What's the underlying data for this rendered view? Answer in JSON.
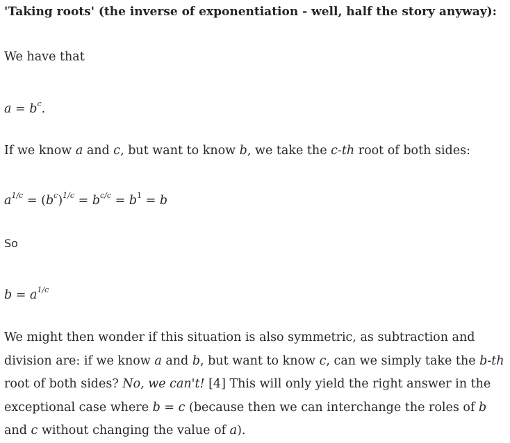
{
  "heading": "'Taking roots' (the inverse of exponentiation - well, half the story anyway):",
  "line_we_have_that": "We have that",
  "eq1": {
    "a": "a",
    "eq": " = ",
    "b": "b",
    "c": "c",
    "dot": "."
  },
  "line_if_we_know": {
    "t1": "If we know ",
    "a": "a",
    "t2": " and ",
    "c": "c",
    "t3": ", but want to know ",
    "b": "b",
    "t4": ", we take the ",
    "cth": "c-th",
    "t5": " root of both sides:"
  },
  "eq2": {
    "a": "a",
    "exp_1c": "1/c",
    "eq": " = ",
    "open": "(",
    "b": "b",
    "c": "c",
    "close": ")",
    "b2": "b",
    "exp_cc": "c/c",
    "b3": "b",
    "exp_1": "1",
    "b4": "b"
  },
  "line_so": "So",
  "eq3": {
    "b": "b",
    "eq": " = ",
    "a": "a",
    "exp_1c": "1/c"
  },
  "paragraph": {
    "p1": "We might then wonder if this situation is also symmetric, as subtraction and division are: if we know ",
    "a": "a",
    "p2": " and ",
    "b": "b",
    "p3": ", but want to know ",
    "c": "c",
    "p4": ", can we simply take the ",
    "bth": "b-th",
    "p5": " root of both sides? ",
    "no": "No, we can't!",
    "p6": " [4] This will only yield the right answer in the exceptional case where ",
    "b2": "b",
    "p7": " = ",
    "c2": "c",
    "p8": " (because then we can interchange the roles of ",
    "b3": "b",
    "p9": " and ",
    "c3": "c",
    "p10": " without changing the value of ",
    "a2": "a",
    "p11": ")."
  }
}
